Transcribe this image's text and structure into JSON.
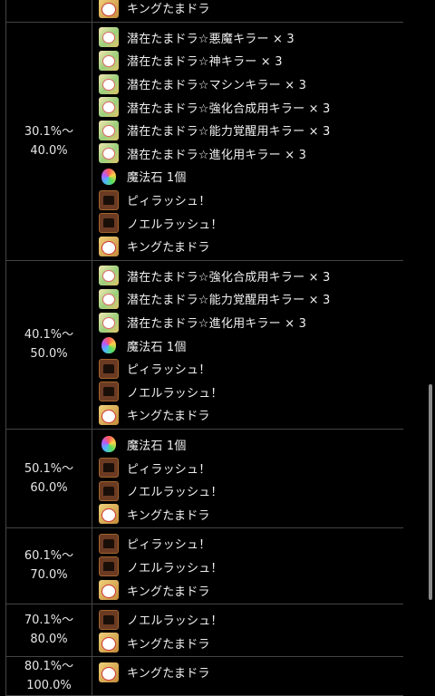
{
  "groups": [
    {
      "range_top": "",
      "range_bottom": "",
      "items": [
        {
          "icon": "king-tamadra-icon",
          "label": "キングたまドラ"
        }
      ]
    },
    {
      "range_top": "30.1%〜",
      "range_bottom": "40.0%",
      "items": [
        {
          "icon": "tamadra-icon",
          "label": "潜在たまドラ☆悪魔キラー × 3"
        },
        {
          "icon": "tamadra-icon",
          "label": "潜在たまドラ☆神キラー × 3"
        },
        {
          "icon": "tamadra-icon",
          "label": "潜在たまドラ☆マシンキラー × 3"
        },
        {
          "icon": "tamadra-icon",
          "label": "潜在たまドラ☆強化合成用キラー × 3"
        },
        {
          "icon": "tamadra-icon",
          "label": "潜在たまドラ☆能力覚醒用キラー × 3"
        },
        {
          "icon": "tamadra-icon",
          "label": "潜在たまドラ☆進化用キラー × 3"
        },
        {
          "icon": "magic-stone-icon",
          "label": "魔法石 1個"
        },
        {
          "icon": "rush-icon",
          "label": "ピィラッシュ！"
        },
        {
          "icon": "rush-icon",
          "label": "ノエルラッシュ！"
        },
        {
          "icon": "king-tamadra-icon",
          "label": "キングたまドラ"
        }
      ]
    },
    {
      "range_top": "40.1%〜",
      "range_bottom": "50.0%",
      "items": [
        {
          "icon": "tamadra-icon",
          "label": "潜在たまドラ☆強化合成用キラー × 3"
        },
        {
          "icon": "tamadra-icon",
          "label": "潜在たまドラ☆能力覚醒用キラー × 3"
        },
        {
          "icon": "tamadra-icon",
          "label": "潜在たまドラ☆進化用キラー × 3"
        },
        {
          "icon": "magic-stone-icon",
          "label": "魔法石 1個"
        },
        {
          "icon": "rush-icon",
          "label": "ピィラッシュ！"
        },
        {
          "icon": "rush-icon",
          "label": "ノエルラッシュ！"
        },
        {
          "icon": "king-tamadra-icon",
          "label": "キングたまドラ"
        }
      ]
    },
    {
      "range_top": "50.1%〜",
      "range_bottom": "60.0%",
      "items": [
        {
          "icon": "magic-stone-icon",
          "label": "魔法石 1個"
        },
        {
          "icon": "rush-icon",
          "label": "ピィラッシュ！"
        },
        {
          "icon": "rush-icon",
          "label": "ノエルラッシュ！"
        },
        {
          "icon": "king-tamadra-icon",
          "label": "キングたまドラ"
        }
      ]
    },
    {
      "range_top": "60.1%〜",
      "range_bottom": "70.0%",
      "items": [
        {
          "icon": "rush-icon",
          "label": "ピィラッシュ！"
        },
        {
          "icon": "rush-icon",
          "label": "ノエルラッシュ！"
        },
        {
          "icon": "king-tamadra-icon",
          "label": "キングたまドラ"
        }
      ]
    },
    {
      "range_top": "70.1%〜",
      "range_bottom": "80.0%",
      "items": [
        {
          "icon": "rush-icon",
          "label": "ノエルラッシュ！"
        },
        {
          "icon": "king-tamadra-icon",
          "label": "キングたまドラ"
        }
      ]
    },
    {
      "range_top": "80.1%〜",
      "range_bottom": "100.0%",
      "items": [
        {
          "icon": "king-tamadra-icon",
          "label": "キングたまドラ"
        }
      ]
    }
  ]
}
